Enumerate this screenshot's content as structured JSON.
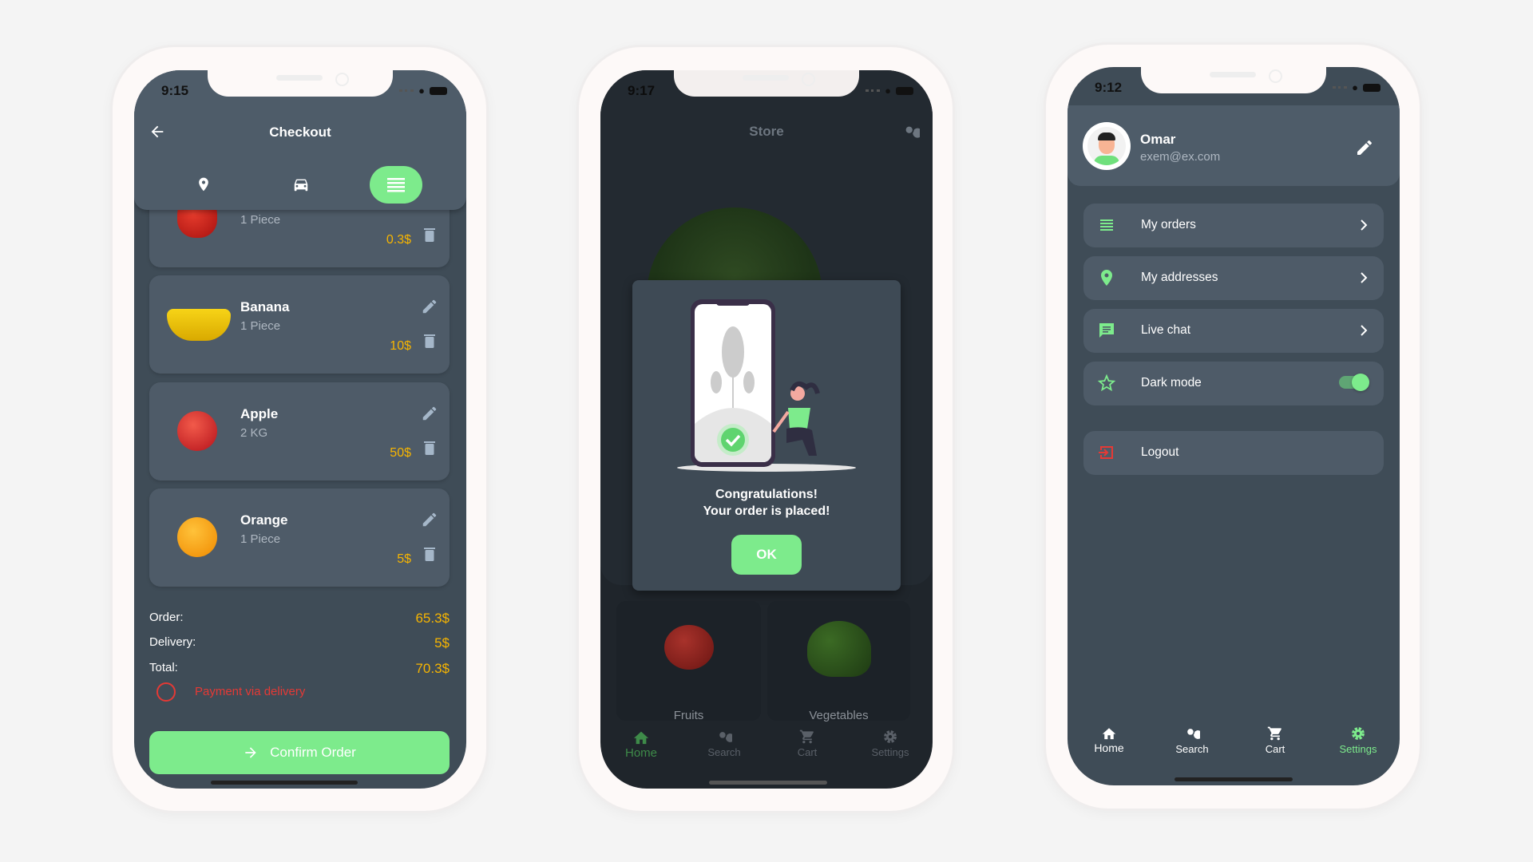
{
  "colors": {
    "accent": "#7deb8c",
    "price": "#f7b500",
    "danger": "#e53935",
    "panel": "#4e5b68",
    "bg": "#3f4c57"
  },
  "checkout": {
    "status_time": "9:15",
    "title": "Checkout",
    "tabs": [
      {
        "icon": "location-pin-icon"
      },
      {
        "icon": "car-icon"
      },
      {
        "icon": "list-icon",
        "active": true
      }
    ],
    "items": [
      {
        "name": "",
        "qty": "1 Piece",
        "price": "0.3$",
        "fruit": "pepper"
      },
      {
        "name": "Banana",
        "qty": "1 Piece",
        "price": "10$",
        "fruit": "banana"
      },
      {
        "name": "Apple",
        "qty": "2 KG",
        "price": "50$",
        "fruit": "apple"
      },
      {
        "name": "Orange",
        "qty": "1 Piece",
        "price": "5$",
        "fruit": "orange"
      }
    ],
    "summary": {
      "order_label": "Order:",
      "order": "65.3$",
      "delivery_label": "Delivery:",
      "delivery": "5$",
      "total_label": "Total:",
      "total": "70.3$"
    },
    "payment_label": "Payment via delivery",
    "payment_selected": false,
    "confirm_label": "Confirm Order"
  },
  "store": {
    "status_time": "9:17",
    "title": "Store",
    "dialog": {
      "line1": "Congratulations!",
      "line2": "Your order is placed!",
      "ok": "OK"
    },
    "categories": [
      {
        "label": "Fruits"
      },
      {
        "label": "Vegetables"
      }
    ],
    "nav": [
      {
        "label": "Home",
        "active": true
      },
      {
        "label": "Search"
      },
      {
        "label": "Cart"
      },
      {
        "label": "Settings"
      }
    ]
  },
  "settings": {
    "status_time": "9:12",
    "profile": {
      "name": "Omar",
      "email": "exem@ex.com"
    },
    "menu": [
      {
        "label": "My orders",
        "icon": "list-icon"
      },
      {
        "label": "My addresses",
        "icon": "location-pin-icon"
      },
      {
        "label": "Live chat",
        "icon": "chat-icon"
      },
      {
        "label": "Dark mode",
        "icon": "star-icon",
        "toggle": true
      }
    ],
    "logout": "Logout",
    "nav": [
      {
        "label": "Home"
      },
      {
        "label": "Search"
      },
      {
        "label": "Cart"
      },
      {
        "label": "Settings",
        "active": true
      }
    ]
  }
}
